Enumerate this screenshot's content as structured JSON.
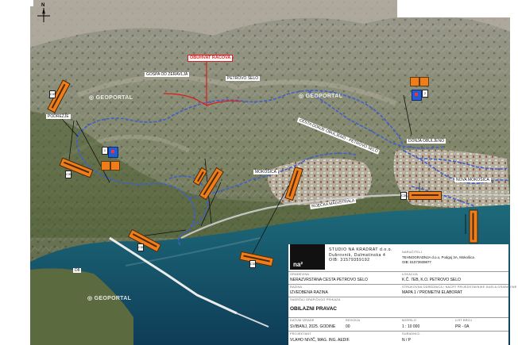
{
  "colors": {
    "route": "#3d5fcf",
    "highlight": "#e21a1a",
    "sign": "#f07d1a",
    "info_sign": "#1e5dd6"
  },
  "map": {
    "places": [
      {
        "id": "gospa",
        "text": "GOSPA OD ZERAVLJA"
      },
      {
        "id": "petrovo",
        "text": "PETROVO SELO"
      },
      {
        "id": "podrezje",
        "text": "PODREŽJE"
      },
      {
        "id": "mokosica",
        "text": "MOKOŠICA"
      },
      {
        "id": "donja",
        "text": "DONJA OBULJENO"
      },
      {
        "id": "nova",
        "text": "NOVA MOKOŠICA"
      },
      {
        "id": "cesta",
        "text": "CESTA DONJE OBULJENO - PETROVO SELO"
      },
      {
        "id": "rijeka",
        "text": "RIJEČKA MAGISTRALA"
      },
      {
        "id": "road_d8",
        "text": "D8"
      }
    ],
    "highlight_label": "OBUHVAT RACOVA",
    "watermarks": [
      "GEOPORTAL",
      "GEOPORTAL",
      "GEOPORTAL"
    ],
    "north_label": "N",
    "sign_codes": [
      "C39",
      "C39",
      "C39",
      "C39",
      "C39",
      "C39",
      "C39",
      "C39",
      "C39"
    ],
    "warn_texts": [
      "A9 A9",
      "A9 A9"
    ],
    "info_code": [
      "1",
      "2"
    ]
  },
  "title_block": {
    "studio_lines": [
      "STUDIO NA KRADRAT d.o.o.",
      "Dubrovnik, Dalmatinska 4",
      "OIB: 31579359192"
    ],
    "logo_text": "na²",
    "gradevina_label": "GRAĐEVINA",
    "gradevina_value": "NERAZVRSTANA CESTA PETROVO SELO",
    "narucitelj_label": "NARUČITELJ",
    "narucitelj_value": "TEHNOGRADNJA d.o.o, Podgoj 3A, Mokošica",
    "narucitelj_oib": "OIB: 81073939877",
    "lokacija_label": "LOKACIJA",
    "lokacija_value": "K.Č. 7EB, K.O. PETROVO SELO",
    "razina_label": "RAZINA",
    "razina_value": "IZVEDBENA RAZINA",
    "struk_label": "STRUKOVNA ODREDNICA / NACRT PRIJEDSTAVNIKE DUELA GRAĐEVINE",
    "struk_value": "MAPA 1 / PROMETNI ELABORAT",
    "sadrzaj_label": "SADRŽAJ GRAFIČKOG PRIKAZA",
    "sadrzaj_value": "OBILAZNI PRAVAC",
    "datum_label": "DATUM IZRADE",
    "datum_value": "SVIBANJ, 2025. GODINE",
    "revizija_label": "REVIZIJA",
    "revizija_value": "00",
    "mjerilo_label": "MJERILO",
    "mjerilo_value": "1 : 10 000",
    "list_label": "LIST BROJ",
    "list_value": "PR - 0A",
    "projektant_label": "PROJEKTANT",
    "projektant_value": "VLAHO NIVIČ, MAG. ING. AEDIF.",
    "suradnici_label": "SURADNICI",
    "suradnici_value": "N / P"
  }
}
